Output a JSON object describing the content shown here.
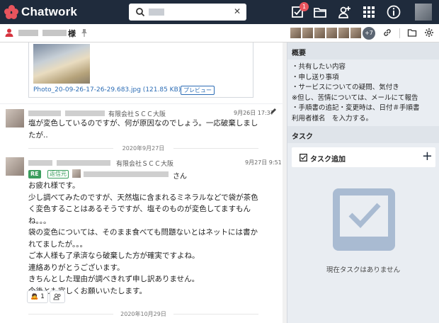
{
  "app": {
    "title": "Chatwork"
  },
  "header": {
    "notification_count": "1"
  },
  "room": {
    "name_suffix": "様",
    "member_extra": "+7"
  },
  "attachment": {
    "file_name": "Photo_20-09-26-17-26-29.683.jpg (121.85 KB)",
    "preview_label": "プレビュー"
  },
  "messages": [
    {
      "company": "有限会社ＳＣＣ大阪",
      "time": "9月26日 17:37",
      "lines": [
        "塩が変色しているのですが、何が原因なのでしょう。一応破棄しまし",
        "たが.."
      ]
    },
    {
      "company": "有限会社ＳＣＣ大阪",
      "time": "9月27日 9:51",
      "re_label": "RE",
      "reply_label": "返信元",
      "reply_suffix": "さん",
      "lines": [
        "お疲れ様です。",
        "少し調べてみたのですが、天然塩に含まれるミネラルなどで袋が茶色",
        "く変色することはあるそうですが、塩そのものが変色してますもん",
        "ね。。。",
        "袋の変色については、そのまま食べても問題ないとはネットには書か",
        "れてましたが。。。",
        "ご本人様も了承済なら破棄した方が確実ですよね。",
        "連絡ありがとうございます。",
        "きちんとした理由が調べきれず申し訳ありません。",
        "今後とも宜しくお願いいたします。"
      ],
      "reaction_count": "1"
    }
  ],
  "date_separators": [
    "2020年9月27日",
    "2020年10月29日"
  ],
  "sidebar": {
    "overview_title": "概要",
    "overview_lines": [
      "・共有したい内容",
      "・申し送り事項",
      "・サービスについての疑問、気付き",
      "※但し、苦情については、メールにて報告",
      "・手順書の追記・変更時は、日付＃手順書",
      "利用者様名　を入力する。"
    ],
    "task_title": "タスク",
    "task_add_label": "タスク追加",
    "task_add_plus": "+",
    "empty_text": "現在タスクはありません"
  },
  "colors": {
    "topbar": "#1f2b3c",
    "accent": "#e8545d",
    "link": "#2b6cb5",
    "reply_green": "#3a9d5d"
  }
}
